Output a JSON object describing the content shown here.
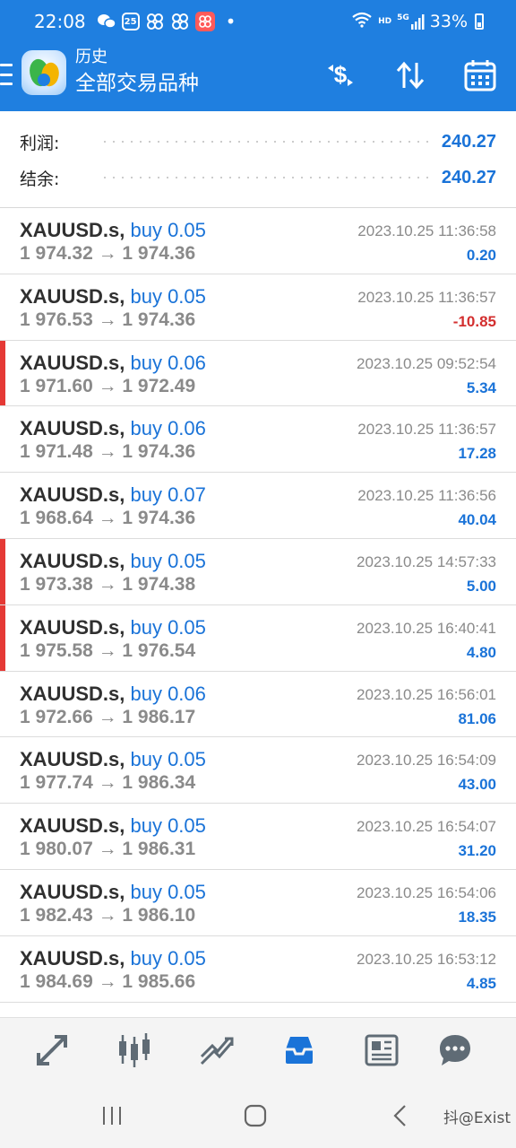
{
  "status_bar": {
    "time": "22:08",
    "notifications": [
      "wechat-icon",
      "calendar-icon",
      "app-icon",
      "app-icon",
      "app-icon"
    ],
    "calendar_day": "25",
    "battery": "33%",
    "network": "HD",
    "signal_label": "5G"
  },
  "app_bar": {
    "subtitle": "历史",
    "title": "全部交易品种",
    "bg_color": "#1f7fe0"
  },
  "summary": {
    "profit_label": "利润:",
    "profit_value": "240.27",
    "balance_label": "结余:",
    "balance_value": "240.27"
  },
  "trades": [
    {
      "symbol": "XAUUSD.s",
      "side": "buy 0.05",
      "prices": "1 974.32 → 1 974.36",
      "time": "2023.10.25 11:36:58",
      "profit": "0.20",
      "negative": false,
      "marked": false
    },
    {
      "symbol": "XAUUSD.s",
      "side": "buy 0.05",
      "prices": "1 976.53 → 1 974.36",
      "time": "2023.10.25 11:36:57",
      "profit": "-10.85",
      "negative": true,
      "marked": false
    },
    {
      "symbol": "XAUUSD.s",
      "side": "buy 0.06",
      "prices": "1 971.60 → 1 972.49",
      "time": "2023.10.25 09:52:54",
      "profit": "5.34",
      "negative": false,
      "marked": true
    },
    {
      "symbol": "XAUUSD.s",
      "side": "buy 0.06",
      "prices": "1 971.48 → 1 974.36",
      "time": "2023.10.25 11:36:57",
      "profit": "17.28",
      "negative": false,
      "marked": false
    },
    {
      "symbol": "XAUUSD.s",
      "side": "buy 0.07",
      "prices": "1 968.64 → 1 974.36",
      "time": "2023.10.25 11:36:56",
      "profit": "40.04",
      "negative": false,
      "marked": false
    },
    {
      "symbol": "XAUUSD.s",
      "side": "buy 0.05",
      "prices": "1 973.38 → 1 974.38",
      "time": "2023.10.25 14:57:33",
      "profit": "5.00",
      "negative": false,
      "marked": true
    },
    {
      "symbol": "XAUUSD.s",
      "side": "buy 0.05",
      "prices": "1 975.58 → 1 976.54",
      "time": "2023.10.25 16:40:41",
      "profit": "4.80",
      "negative": false,
      "marked": true
    },
    {
      "symbol": "XAUUSD.s",
      "side": "buy 0.06",
      "prices": "1 972.66 → 1 986.17",
      "time": "2023.10.25 16:56:01",
      "profit": "81.06",
      "negative": false,
      "marked": false
    },
    {
      "symbol": "XAUUSD.s",
      "side": "buy 0.05",
      "prices": "1 977.74 → 1 986.34",
      "time": "2023.10.25 16:54:09",
      "profit": "43.00",
      "negative": false,
      "marked": false
    },
    {
      "symbol": "XAUUSD.s",
      "side": "buy 0.05",
      "prices": "1 980.07 → 1 986.31",
      "time": "2023.10.25 16:54:07",
      "profit": "31.20",
      "negative": false,
      "marked": false
    },
    {
      "symbol": "XAUUSD.s",
      "side": "buy 0.05",
      "prices": "1 982.43 → 1 986.10",
      "time": "2023.10.25 16:54:06",
      "profit": "18.35",
      "negative": false,
      "marked": false
    },
    {
      "symbol": "XAUUSD.s",
      "side": "buy 0.05",
      "prices": "1 984.69 → 1 985.66",
      "time": "2023.10.25 16:53:12",
      "profit": "4.85",
      "negative": false,
      "marked": false
    }
  ],
  "bottom_nav": [
    "quotes-icon",
    "chart-icon",
    "trade-icon",
    "history-icon",
    "news-icon",
    "messages-icon"
  ],
  "active_nav": "history-icon",
  "colors": {
    "accent": "#1a73d8",
    "negative": "#d32f2f",
    "marker": "#e53935"
  },
  "watermark": "抖@Exist"
}
